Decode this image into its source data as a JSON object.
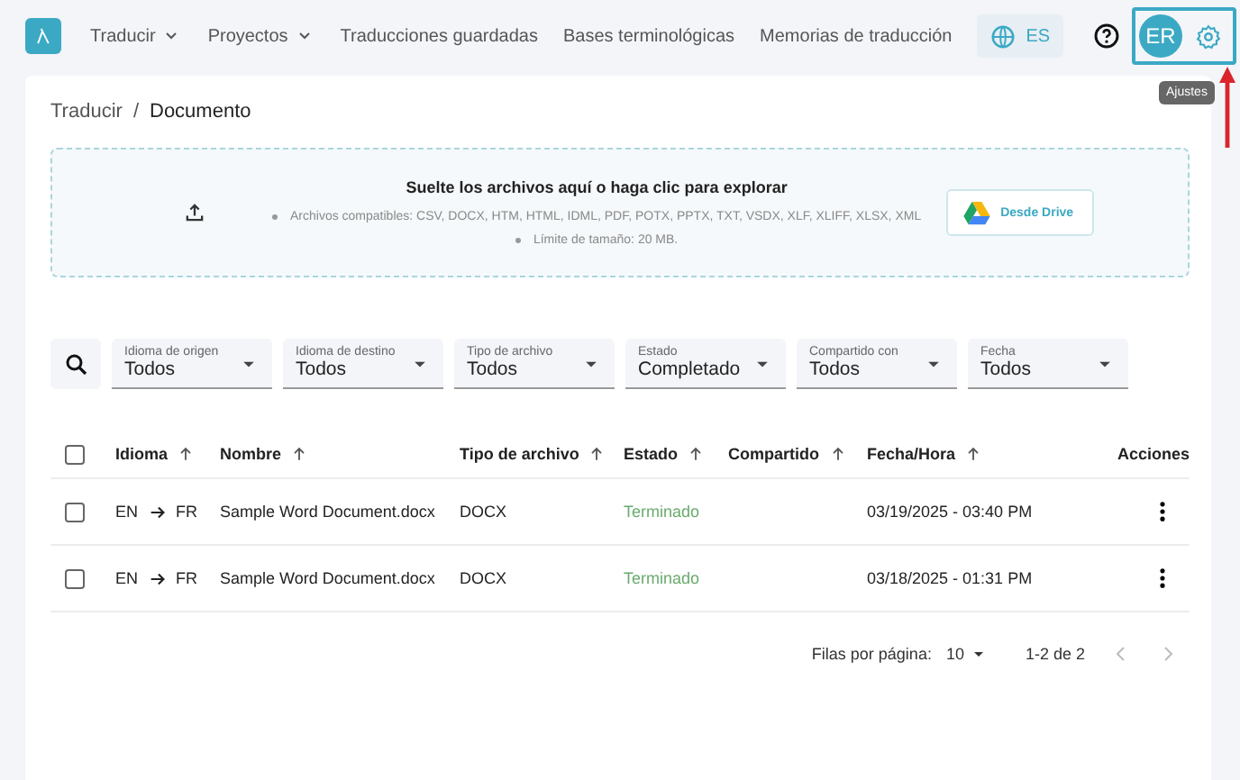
{
  "nav": {
    "menu": [
      {
        "label": "Traducir",
        "dropdown": true
      },
      {
        "label": "Proyectos",
        "dropdown": true
      },
      {
        "label": "Traducciones guardadas",
        "dropdown": false
      },
      {
        "label": "Bases terminológicas",
        "dropdown": false
      },
      {
        "label": "Memorias de traducción",
        "dropdown": false
      }
    ],
    "language": "ES",
    "user_initials": "ER",
    "settings_tooltip": "Ajustes",
    "settings_highlighted": true
  },
  "breadcrumb": {
    "items": [
      "Traducir",
      "Documento"
    ],
    "separator": "/"
  },
  "upload": {
    "title": "Suelte los archivos aquí o haga clic para explorar",
    "notes": [
      "Archivos compatibles: CSV, DOCX, HTM, HTML, IDML, PDF, POTX, PPTX, TXT, VSDX, XLF, XLIFF, XLSX, XML",
      "Límite de tamaño: 20 MB."
    ],
    "drive_button": "Desde Drive"
  },
  "filters": [
    {
      "label": "Idioma de origen",
      "value": "Todos"
    },
    {
      "label": "Idioma de destino",
      "value": "Todos"
    },
    {
      "label": "Tipo de archivo",
      "value": "Todos"
    },
    {
      "label": "Estado",
      "value": "Completado"
    },
    {
      "label": "Compartido con",
      "value": "Todos"
    },
    {
      "label": "Fecha",
      "value": "Todos"
    }
  ],
  "table": {
    "all_checked": false,
    "columns": [
      {
        "label": "Idioma",
        "sortable": true
      },
      {
        "label": "Nombre",
        "sortable": true
      },
      {
        "label": "Tipo de archivo",
        "sortable": true
      },
      {
        "label": "Estado",
        "sortable": true
      },
      {
        "label": "Compartido",
        "sortable": true
      },
      {
        "label": "Fecha/Hora",
        "sortable": true
      },
      {
        "label": "Acciones",
        "sortable": false
      }
    ],
    "rows": [
      {
        "checked": false,
        "source": "EN",
        "target": "FR",
        "name": "Sample Word Document.docx",
        "type": "DOCX",
        "status": "Terminado",
        "date": "03/19/2025 - 03:40 PM"
      },
      {
        "checked": false,
        "source": "EN",
        "target": "FR",
        "name": "Sample Word Document.docx",
        "type": "DOCX",
        "status": "Terminado",
        "date": "03/18/2025 - 01:31 PM"
      }
    ]
  },
  "pagination": {
    "rows_label": "Filas por página:",
    "rows_per_page": "10",
    "range": "1-2 de 2",
    "prev_disabled": true,
    "next_disabled": true
  }
}
